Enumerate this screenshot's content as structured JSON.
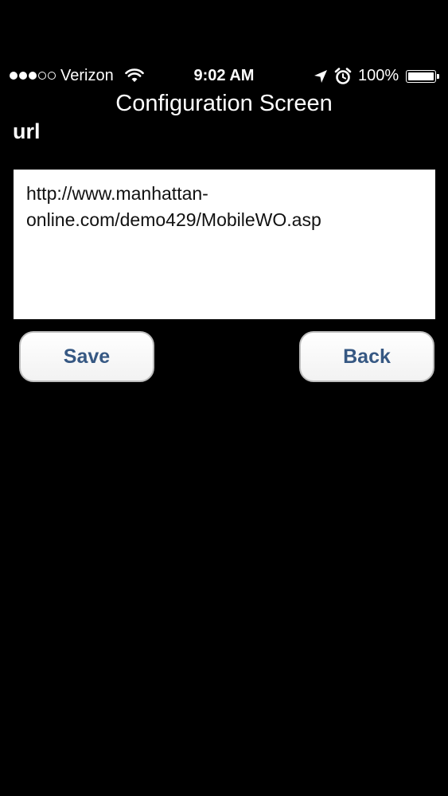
{
  "status_bar": {
    "signal_strength": 3,
    "signal_max": 5,
    "carrier": "Verizon",
    "time": "9:02 AM",
    "battery_percent": "100%",
    "battery_level": 1.0
  },
  "screen": {
    "title": "Configuration Screen",
    "field_label": "url",
    "url_value": "http://www.manhattan-online.com/demo429/MobileWO.asp"
  },
  "buttons": {
    "save_label": "Save",
    "back_label": "Back"
  },
  "colors": {
    "background": "#000000",
    "button_text": "#365883",
    "text_field_bg": "#ffffff"
  },
  "icons": {
    "signal": "signal-dots-icon",
    "wifi": "wifi-icon",
    "location": "location-arrow-icon",
    "alarm": "alarm-clock-icon",
    "battery": "battery-icon"
  }
}
